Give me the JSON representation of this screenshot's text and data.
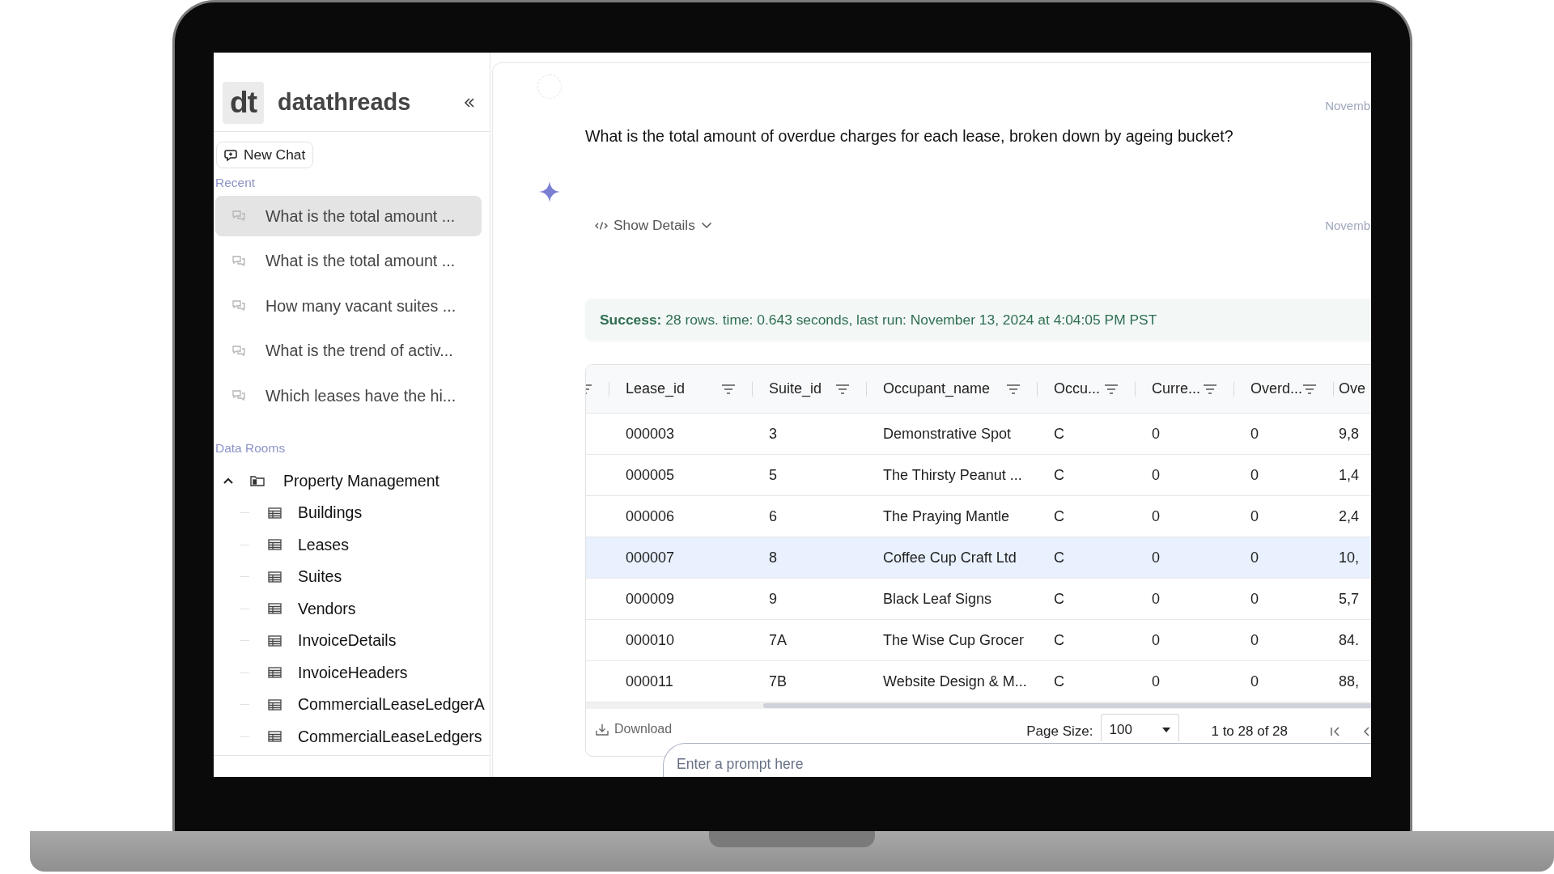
{
  "sidebar": {
    "logo": "dt",
    "brand": "datathreads",
    "new_chat": "New Chat",
    "recent_label": "Recent",
    "recent": [
      {
        "label": "What is the total amount ...",
        "selected": true
      },
      {
        "label": "What is the total amount ...",
        "selected": false
      },
      {
        "label": "How many vacant suites ...",
        "selected": false
      },
      {
        "label": "What is the trend of activ...",
        "selected": false
      },
      {
        "label": "Which leases have the hi...",
        "selected": false
      }
    ],
    "data_rooms_label": "Data Rooms",
    "tree": [
      {
        "label": "Property Management",
        "expanded": true,
        "children": [
          {
            "label": "Buildings"
          },
          {
            "label": "Leases"
          },
          {
            "label": "Suites"
          },
          {
            "label": "Vendors"
          },
          {
            "label": "InvoiceDetails"
          },
          {
            "label": "InvoiceHeaders"
          },
          {
            "label": "CommercialLeaseLedgerA"
          },
          {
            "label": "CommercialLeaseLedgers"
          }
        ]
      }
    ]
  },
  "chat": {
    "messages": [
      {
        "kind": "user",
        "timestamp": "Novemb",
        "text": "What is the total amount of overdue charges for each lease, broken down by ageing bucket?"
      },
      {
        "kind": "assistant",
        "timestamp": "Novemb",
        "details_toggle": {
          "label": "Show Details",
          "expanded": false
        },
        "status": "**Success:** 28 rows. time: 0.643 seconds, last run: November 13, 2024 at 4:04:05 PM PST",
        "table": {
          "columns": [
            {
              "kind": "stub"
            },
            {
              "kind": "field",
              "label": "Lease_id"
            },
            {
              "kind": "field",
              "label": "Suite_id"
            },
            {
              "kind": "field",
              "label": "Occupant_name"
            },
            {
              "kind": "field",
              "label": "Occu..."
            },
            {
              "kind": "field",
              "label": "Curre..."
            },
            {
              "kind": "field",
              "label": "Overd..."
            },
            {
              "kind": "cut",
              "label": "Ove"
            }
          ],
          "rows": [
            {
              "selected": false,
              "cells": [
                "",
                "000003",
                "3",
                "Demonstrative Spot",
                "C",
                "0",
                "0",
                "9,8"
              ]
            },
            {
              "selected": false,
              "cells": [
                "",
                "000005",
                "5",
                "The Thirsty Peanut ...",
                "C",
                "0",
                "0",
                "1,4"
              ]
            },
            {
              "selected": false,
              "cells": [
                "",
                "000006",
                "6",
                "The Praying Mantle",
                "C",
                "0",
                "0",
                "2,4"
              ]
            },
            {
              "selected": true,
              "cells": [
                "",
                "000007",
                "8",
                "Coffee Cup Craft Ltd",
                "C",
                "0",
                "0",
                "10,"
              ]
            },
            {
              "selected": false,
              "cells": [
                "",
                "000009",
                "9",
                "Black Leaf Signs",
                "C",
                "0",
                "0",
                "5,7"
              ]
            },
            {
              "selected": false,
              "cells": [
                "",
                "000010",
                "7A",
                "The Wise Cup Grocer",
                "C",
                "0",
                "0",
                "84."
              ]
            },
            {
              "selected": false,
              "cells": [
                "",
                "000011",
                "7B",
                "Website Design & M...",
                "C",
                "0",
                "0",
                "88,"
              ]
            }
          ],
          "download": "Download",
          "page_size_label": "Page Size:",
          "page_size": "100",
          "range": "1 to 28 of 28"
        }
      }
    ],
    "prompt": {
      "placeholder": "Enter a prompt here"
    }
  }
}
